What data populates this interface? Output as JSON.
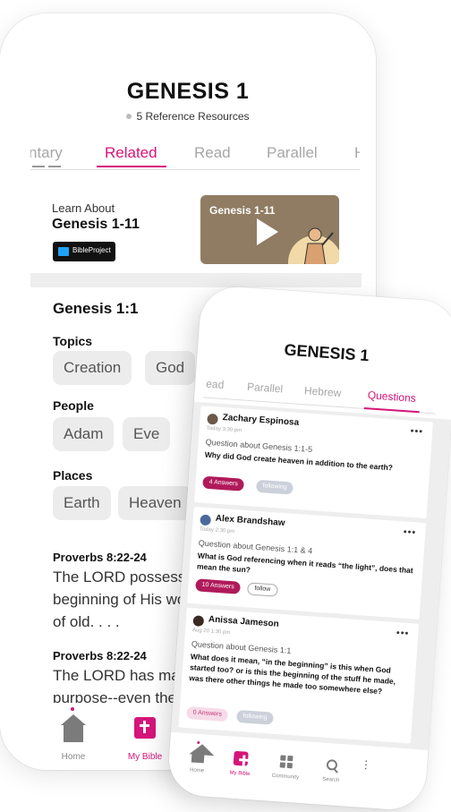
{
  "back_phone": {
    "title": "GENESIS 1",
    "subtitle": "5 Reference Resources",
    "tabs": [
      "ntary",
      "Related",
      "Read",
      "Parallel",
      "H"
    ],
    "active_tab": "Related",
    "learn": {
      "label": "Learn About",
      "title": "Genesis 1-11",
      "badge": "BibleProject",
      "video_title": "Genesis 1-11"
    },
    "verse_ref": "Genesis 1:1",
    "topics_label": "Topics",
    "topics": [
      "Creation",
      "God"
    ],
    "people_label": "People",
    "people": [
      "Adam",
      "Eve"
    ],
    "places_label": "Places",
    "places": [
      "Earth",
      "Heaven"
    ],
    "passages": [
      {
        "cite": "Proverbs 8:22-24",
        "lines": [
          "The LORD possessed",
          "beginning of His wor",
          "of old. . . ."
        ]
      },
      {
        "cite": "Proverbs 8:22-24",
        "lines": [
          "The LORD has made",
          "purpose--even the"
        ]
      }
    ],
    "nav": [
      "Home",
      "My Bible"
    ]
  },
  "front_phone": {
    "title": "GENESIS 1",
    "tabs": [
      "ead",
      "Parallel",
      "Hebrew",
      "Questions"
    ],
    "active_tab": "Questions",
    "questions": [
      {
        "name": "Zachary Espinosa",
        "time": "Today 3:30 pm",
        "about": "Question about Genesis 1:1-5",
        "text": "Why did God create heaven in addition to the earth?",
        "answers": "4 Answers",
        "follow": "following"
      },
      {
        "name": "Alex Brandshaw",
        "time": "Today 2:30 pm",
        "about": "Question about Genesis 1:1 & 4",
        "text": "What is God referencing when it reads “the light”, does that mean the sun?",
        "answers": "10 Answers",
        "follow": "follow"
      },
      {
        "name": "Anissa Jameson",
        "time": "Aug 20 1:30 pm",
        "about": "Question about Genesis 1:1",
        "text": "What does it mean, “in the beginning” is this when God started too? or is this the beginning of the stuff he made, was there other things he made too somewhere else?",
        "answers": "0 Answers",
        "follow": "following"
      }
    ],
    "nav": [
      "Home",
      "My Bible",
      "Community",
      "Search"
    ]
  },
  "colors": {
    "accent": "#d5157a",
    "answers_pill": "#b01a5a",
    "video_bg": "#8f7c62"
  }
}
